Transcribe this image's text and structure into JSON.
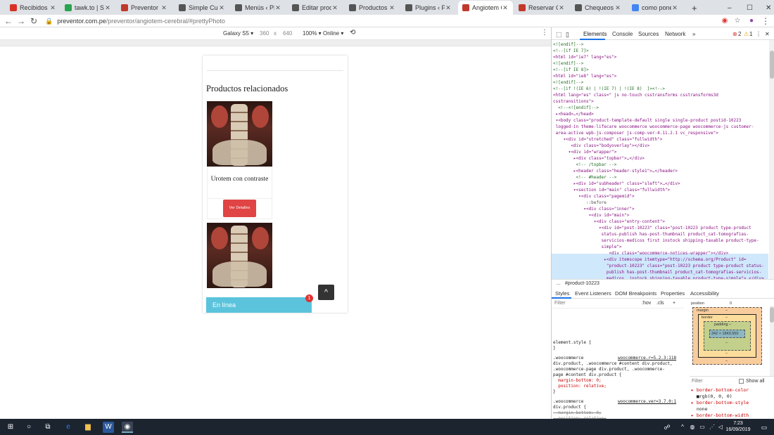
{
  "browser": {
    "tabs": [
      {
        "title": "Recibidos (7.8…",
        "icon": "gmail-icon",
        "color": "#d93025"
      },
      {
        "title": "tawk.to | Supe…",
        "icon": "tawk-icon",
        "color": "#2aa44f"
      },
      {
        "title": "Preventor Pen…",
        "icon": "preventor-icon",
        "color": "#c0392b"
      },
      {
        "title": "Simple Custom…",
        "icon": "globe-icon",
        "color": "#555555"
      },
      {
        "title": "Menús ‹ PREV…",
        "icon": "globe-icon",
        "color": "#555555"
      },
      {
        "title": "Editar product…",
        "icon": "globe-icon",
        "color": "#555555"
      },
      {
        "title": "Productos ‹ PR…",
        "icon": "globe-icon",
        "color": "#555555"
      },
      {
        "title": "Plugins ‹ PREV…",
        "icon": "globe-icon",
        "color": "#555555"
      },
      {
        "title": "Angiotem Ce…",
        "icon": "preventor-icon",
        "color": "#c0392b"
      },
      {
        "title": "Reservar Cita…",
        "icon": "preventor-icon",
        "color": "#c0392b"
      },
      {
        "title": "Chequeos On…",
        "icon": "globe-icon",
        "color": "#555555"
      },
      {
        "title": "como poner a…",
        "icon": "google-icon",
        "color": "#4285f4"
      }
    ],
    "new_tab": "+",
    "window_controls": [
      "–",
      "☐",
      "✕"
    ],
    "url_domain": "preventor.com.pe",
    "url_path": "/preventor/angiotem-cerebral/#prettyPhoto"
  },
  "device_toolbar": {
    "device": "Galaxy S5 ▾",
    "width": "360",
    "x": "x",
    "height": "640",
    "zoom": "100% ▾",
    "network": "Online ▾"
  },
  "page": {
    "section_title": "Productos relacionados",
    "product1_title": "Urotem con contraste",
    "product1_button": "Ver Detalles",
    "chat_label": "En línea",
    "chat_badge": "1",
    "scroll_top_icon": "^"
  },
  "devtools": {
    "tabs": [
      "Elements",
      "Console",
      "Sources",
      "Network",
      "»"
    ],
    "errors": "2",
    "warnings": "1",
    "selected_node": "#product-10223",
    "style_tabs": [
      "Styles",
      "Event Listeners",
      "DOM Breakpoints",
      "Properties",
      "Accessibility"
    ],
    "filter_placeholder": "Filter",
    "filter_hov": ":hov",
    "filter_cls": ".cls",
    "filter_add": "+",
    "box_model": {
      "position_label": "position",
      "position_value": "0",
      "margin_label": "margin",
      "margin_value": "–",
      "border_label": "border",
      "border_value": "–",
      "padding_label": "padding –",
      "content": "342 × 1843.550",
      "dash": "–"
    },
    "computed_filter": "Filter",
    "show_all": "Show all",
    "computed": [
      "▸ border-bottom-color",
      "  ■rgb(0, 0, 0)",
      "▸ border-bottom-style",
      "  none",
      "▸ border-bottom-width"
    ],
    "styles_lines": [
      "element.style {",
      "}",
      ".woocommerce",
      "div.product, .woocommerce #content div.product,",
      ".woocommerce-page div.product, .woocommerce-",
      "page #content div.product {",
      "  margin-bottom: 0;",
      "  position: relative;",
      "}",
      ".woocommerce",
      "div.product {",
      "  margin-bottom: 0;",
      "  position: relative;",
      "}",
      "html, body, div, span,",
      "applet, object, iframe, h1, h2, h3, h4, h5, h6,",
      "p, blockquote, pre, a, abbr, acronym, address,"
    ],
    "style_sources": [
      "woocommerce.r=5.2.3:118",
      "woocommerce.ver=3.7.0:1",
      "style.css?ver=3.0.2:42"
    ],
    "elements_lines": [
      "<![endif]-->",
      "<!--[if IE 7]>",
      "<html id=\"ie7\" lang=\"es\">",
      "<![endif]-->",
      "<!--[if IE 8]>",
      "<html id=\"ie8\" lang=\"es\">",
      "<![endif]-->",
      "<!--[if !(IE 6) | !(IE 7) | !(IE 8)  ]><!-->",
      "<html lang=\"es\" class=\" js no-touch csstransforms csstransforms3d",
      "csstransitions\">",
      "  <!--<![endif]-->",
      " ▸<head>…</head>",
      " ▾<body class=\"product-template-default single single-product postid-10223",
      " logged-in theme-lifecare woocommerce woocommerce-page woocommerce-js customer-",
      " area-active wpb-js-composer js-comp-ver-4.11.2.1 vc_responsive\">",
      "    ▾<div id=\"stretched\" class=\"fullwidth\">",
      "       <div class=\"bodyoverlay\"></div>",
      "      ▾<div id=\"wrapper\">",
      "        ▸<div class=\"topbar\">…</div>",
      "         <!-- /topbar -->",
      "        ▸<header class=\"header-style1\">…</header>",
      "         <!-- #header -->",
      "        ▸<div id=\"subheader\" class=\"sleft\">…</div>",
      "        ▾<section id=\"main\" class=\"fullwidth\">",
      "          ▾<div class=\"pagemid\">",
      "             ::before",
      "            ▾<div class=\"inner\">",
      "              ▾<div id=\"main\">",
      "                ▾<div class=\"entry-content\">",
      "                  ▾<div id=\"post-10223\" class=\"post-10223 product type-product",
      "                   status-publish has-post-thumbnail product_cat-tomografias-",
      "                   servicios-medicos first instock shipping-taxable product-type-",
      "                   simple\">",
      "                      <div class=\"woocommerce-notices-wrapper\"></div>",
      "                    ▸<div itemscope itemtype=\"http://schema.org/Product\" id=",
      "                     \"product-10223\" class=\"post-10223 product type-product status-",
      "                     publish has-post-thumbnail product_cat-tomografias-servicios-",
      "                     medicos  instock shipping-taxable product-type-simple\">…</div>"
    ]
  },
  "taskbar": {
    "time": "7:23",
    "date": "16/09/2019"
  }
}
